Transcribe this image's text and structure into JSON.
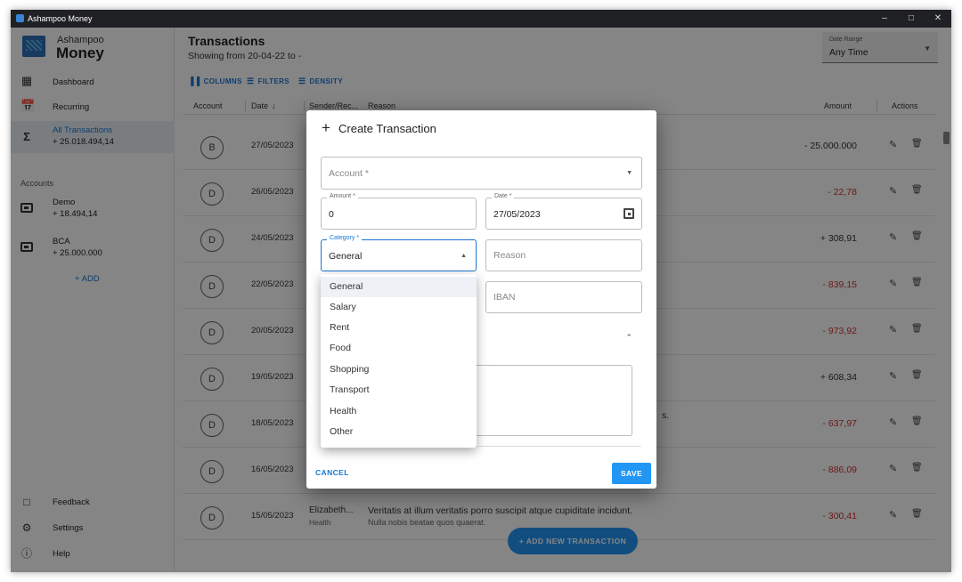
{
  "window": {
    "title": "Ashampoo Money"
  },
  "sidebar": {
    "brand_top": "Ashampoo",
    "brand_main": "Money",
    "nav": [
      {
        "label": "Dashboard",
        "icon": "dashboard-icon"
      },
      {
        "label": "Recurring",
        "icon": "recurring-icon"
      },
      {
        "label": "All Transactions",
        "sub": "+ 25.018.494,14",
        "icon": "sigma-icon"
      }
    ],
    "accounts_label": "Accounts",
    "accounts": [
      {
        "name": "Demo",
        "balance": "+ 18.494,14"
      },
      {
        "name": "BCA",
        "balance": "+ 25.000.000"
      }
    ],
    "add_label": "ADD",
    "bottom": [
      {
        "label": "Feedback",
        "icon": "feedback-icon"
      },
      {
        "label": "Settings",
        "icon": "gear-icon"
      },
      {
        "label": "Help",
        "icon": "help-icon"
      }
    ]
  },
  "main": {
    "title": "Transactions",
    "subtitle": "Showing from 20-04-22 to -",
    "date_range": {
      "label": "Date Range",
      "value": "Any Time"
    },
    "toolbar": {
      "columns": "COLUMNS",
      "filters": "FILTERS",
      "density": "DENSITY"
    },
    "headers": {
      "account": "Account",
      "date": "Date",
      "sender": "Sender/Rec...",
      "reason": "Reason",
      "amount": "Amount",
      "actions": "Actions"
    },
    "rows": [
      {
        "avatar": "B",
        "date": "27/05/2023",
        "amount": "- 25.000.000",
        "color": "#333333"
      },
      {
        "avatar": "D",
        "date": "26/05/2023",
        "amount": "- 22,78",
        "color": "#d32f2f"
      },
      {
        "avatar": "D",
        "date": "24/05/2023",
        "amount": "+ 308,91",
        "color": "#333333"
      },
      {
        "avatar": "D",
        "date": "22/05/2023",
        "amount": "- 839,15",
        "color": "#d32f2f"
      },
      {
        "avatar": "D",
        "date": "20/05/2023",
        "amount": "- 973,92",
        "color": "#d32f2f"
      },
      {
        "avatar": "D",
        "date": "19/05/2023",
        "amount": "+ 608,34",
        "color": "#333333"
      },
      {
        "avatar": "D",
        "date": "18/05/2023",
        "amount": "- 637,97",
        "color": "#d32f2f",
        "reason_tail": "s."
      },
      {
        "avatar": "D",
        "date": "16/05/2023",
        "amount": "- 886,09",
        "color": "#d32f2f"
      },
      {
        "avatar": "D",
        "date": "15/05/2023",
        "amount": "- 300,41",
        "color": "#d32f2f",
        "sender": "Elizabeth...",
        "category": "Health",
        "reason": "Veritatis at illum veritatis porro suscipit atque cupiditate incidunt.",
        "reason2": "Nulla nobis beatae quos quaerat."
      }
    ],
    "fab_label": "ADD NEW TRANSACTION"
  },
  "dialog": {
    "title": "Create Transaction",
    "account_placeholder": "Account *",
    "amount_label": "Amount *",
    "amount_value": "0",
    "date_label": "Date *",
    "date_value": "27/05/2023",
    "category_label": "Category *",
    "category_value": "General",
    "reason_placeholder": "Reason",
    "iban_placeholder": "IBAN",
    "cancel": "CANCEL",
    "save": "SAVE"
  },
  "dropdown": {
    "options": [
      "General",
      "Salary",
      "Rent",
      "Food",
      "Shopping",
      "Transport",
      "Health",
      "Other"
    ],
    "selected": "General"
  },
  "colors": {
    "accent": "#1976d2",
    "negative": "#d32f2f",
    "fab": "#2196f3"
  }
}
